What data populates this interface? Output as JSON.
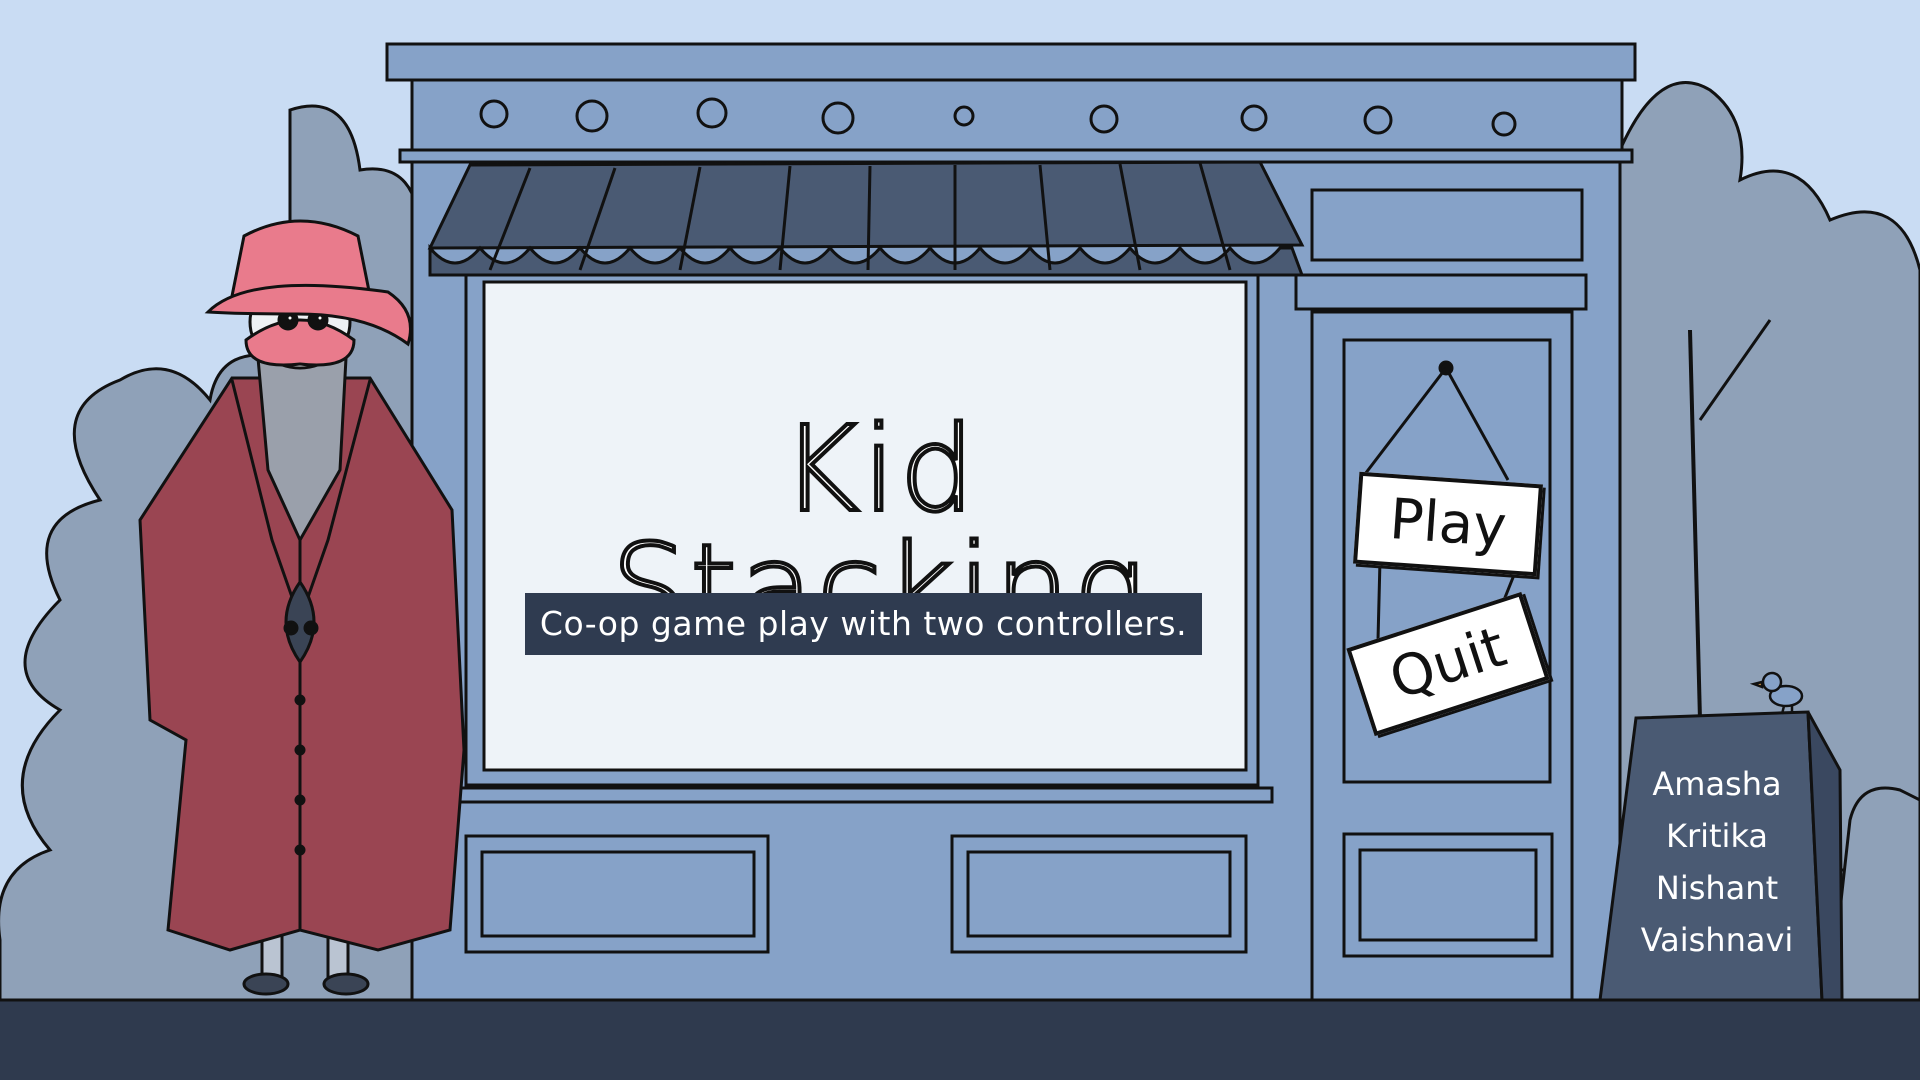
{
  "game": {
    "title": "Kid Stacking",
    "subtitle": "Co-op game play with two controllers."
  },
  "menu": {
    "play_label": "Play",
    "quit_label": "Quit"
  },
  "credits": {
    "names": [
      "Amasha",
      "Kritika",
      "Nishant",
      "Vaishnavi"
    ]
  },
  "colors": {
    "sky": "#c9dcf3",
    "storefront": "#86a2c8",
    "awning": "#4a5a73",
    "window": "#eef3f8",
    "coat": "#9a4552",
    "hat": "#e97b8c",
    "trees": "#8fa1b8",
    "ground": "#2f3a4e",
    "sign_board": "#4a5a73"
  }
}
